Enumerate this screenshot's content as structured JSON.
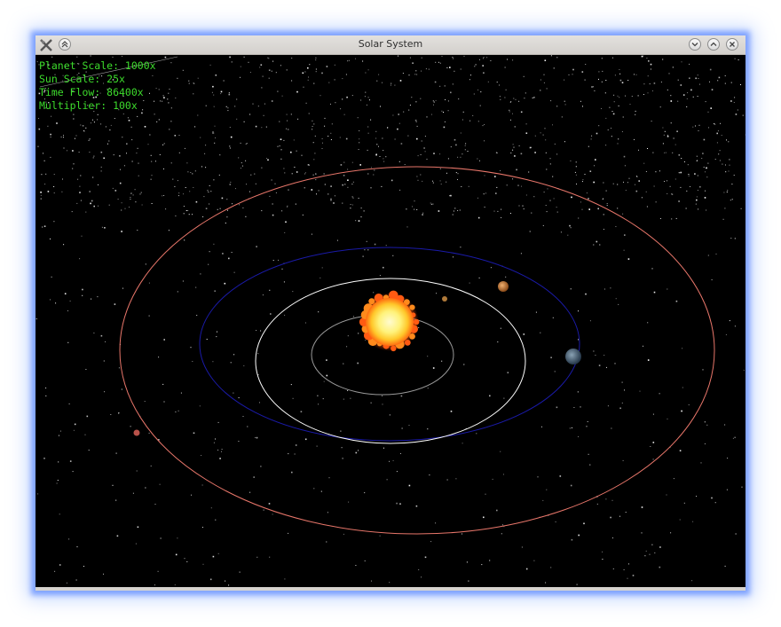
{
  "window": {
    "title": "Solar System",
    "accent_color": "#7aa2ff"
  },
  "titlebar": {
    "left_icons": [
      "app-menu-icon",
      "keep-above-icon"
    ],
    "right_icons": [
      "minimize-icon",
      "maximize-icon",
      "close-icon"
    ]
  },
  "hud": {
    "planet_scale": "Planet Scale: 1000x",
    "sun_scale": "Sun Scale: 25x",
    "time_flow": "Time Flow: 86400x",
    "multiplier": "Multiplier: 100x",
    "text_color": "#3ddc2c"
  },
  "scene": {
    "background_color": "#000000",
    "sun_color": "#fff27a",
    "orbit_colors": {
      "mercury": "#9a9a9a",
      "venus": "#ffffff",
      "earth": "#1a1aa8",
      "mars": "#e8766a"
    }
  }
}
